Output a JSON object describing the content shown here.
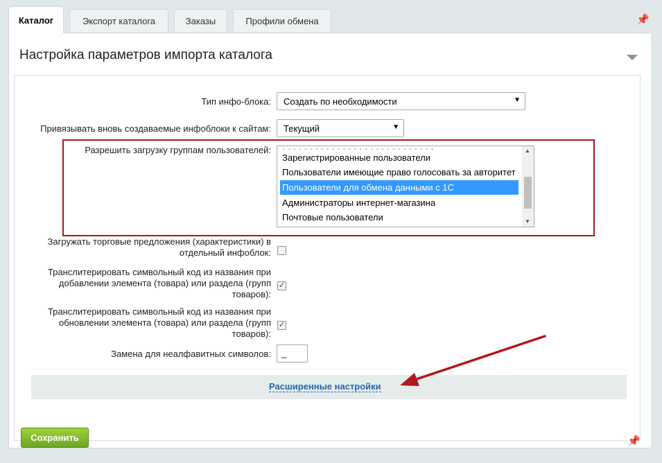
{
  "tabs": [
    {
      "label": "Каталог",
      "active": true
    },
    {
      "label": "Экспорт каталога",
      "active": false
    },
    {
      "label": "Заказы",
      "active": false
    },
    {
      "label": "Профили обмена",
      "active": false
    }
  ],
  "panel": {
    "title": "Настройка параметров импорта каталога"
  },
  "form": {
    "iblock_type": {
      "label": "Тип инфо-блока:",
      "value": "Создать по необходимости"
    },
    "bind_sites": {
      "label": "Привязывать вновь создаваемые инфоблоки к сайтам:",
      "value": "Текущий"
    },
    "user_groups": {
      "label": "Разрешить загрузку группам пользователей:",
      "options": [
        "Зарегистрированные пользователи",
        "Пользователи имеющие право голосовать за авторитет",
        "Пользователи для обмена данными с 1С",
        "Администраторы интернет-магазина",
        "Почтовые пользователи"
      ],
      "selected": "Пользователи для обмена данными с 1С"
    },
    "offers_separate": {
      "label": "Загружать торговые предложения (характеристики) в отдельный инфоблок:",
      "checked": false
    },
    "translit_add": {
      "label": "Транслитерировать символьный код из названия при добавлении элемента (товара) или раздела (групп товаров):",
      "checked": true
    },
    "translit_update": {
      "label": "Транслитерировать символьный код из названия при обновлении элемента (товара) или раздела (групп товаров):",
      "checked": true
    },
    "replace_char": {
      "label": "Замена для неалфавитных символов:",
      "value": "_"
    }
  },
  "advanced_link": "Расширенные настройки",
  "save_button": "Сохранить",
  "colors": {
    "highlight_box": "#a8171b",
    "annotation_arrow": "#b3161b",
    "save_button": "#7db42c",
    "link": "#2067b0"
  },
  "icons": [
    "pin-icon",
    "collapse-arrow-icon",
    "dropdown-caret-icon",
    "checkmark-icon"
  ]
}
